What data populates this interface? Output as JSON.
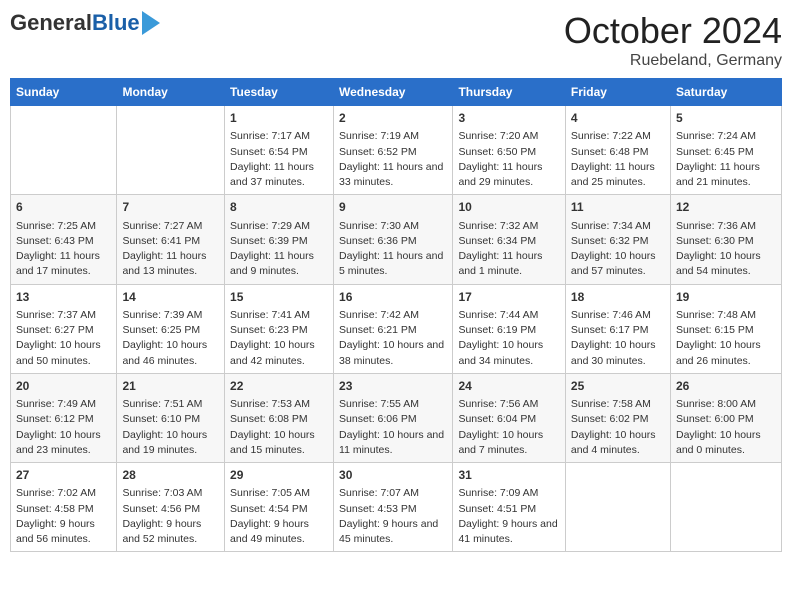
{
  "header": {
    "logo_general": "General",
    "logo_blue": "Blue",
    "title": "October 2024",
    "subtitle": "Ruebeland, Germany"
  },
  "days_of_week": [
    "Sunday",
    "Monday",
    "Tuesday",
    "Wednesday",
    "Thursday",
    "Friday",
    "Saturday"
  ],
  "weeks": [
    [
      {
        "day": "",
        "info": ""
      },
      {
        "day": "",
        "info": ""
      },
      {
        "day": "1",
        "info": "Sunrise: 7:17 AM\nSunset: 6:54 PM\nDaylight: 11 hours and 37 minutes."
      },
      {
        "day": "2",
        "info": "Sunrise: 7:19 AM\nSunset: 6:52 PM\nDaylight: 11 hours and 33 minutes."
      },
      {
        "day": "3",
        "info": "Sunrise: 7:20 AM\nSunset: 6:50 PM\nDaylight: 11 hours and 29 minutes."
      },
      {
        "day": "4",
        "info": "Sunrise: 7:22 AM\nSunset: 6:48 PM\nDaylight: 11 hours and 25 minutes."
      },
      {
        "day": "5",
        "info": "Sunrise: 7:24 AM\nSunset: 6:45 PM\nDaylight: 11 hours and 21 minutes."
      }
    ],
    [
      {
        "day": "6",
        "info": "Sunrise: 7:25 AM\nSunset: 6:43 PM\nDaylight: 11 hours and 17 minutes."
      },
      {
        "day": "7",
        "info": "Sunrise: 7:27 AM\nSunset: 6:41 PM\nDaylight: 11 hours and 13 minutes."
      },
      {
        "day": "8",
        "info": "Sunrise: 7:29 AM\nSunset: 6:39 PM\nDaylight: 11 hours and 9 minutes."
      },
      {
        "day": "9",
        "info": "Sunrise: 7:30 AM\nSunset: 6:36 PM\nDaylight: 11 hours and 5 minutes."
      },
      {
        "day": "10",
        "info": "Sunrise: 7:32 AM\nSunset: 6:34 PM\nDaylight: 11 hours and 1 minute."
      },
      {
        "day": "11",
        "info": "Sunrise: 7:34 AM\nSunset: 6:32 PM\nDaylight: 10 hours and 57 minutes."
      },
      {
        "day": "12",
        "info": "Sunrise: 7:36 AM\nSunset: 6:30 PM\nDaylight: 10 hours and 54 minutes."
      }
    ],
    [
      {
        "day": "13",
        "info": "Sunrise: 7:37 AM\nSunset: 6:27 PM\nDaylight: 10 hours and 50 minutes."
      },
      {
        "day": "14",
        "info": "Sunrise: 7:39 AM\nSunset: 6:25 PM\nDaylight: 10 hours and 46 minutes."
      },
      {
        "day": "15",
        "info": "Sunrise: 7:41 AM\nSunset: 6:23 PM\nDaylight: 10 hours and 42 minutes."
      },
      {
        "day": "16",
        "info": "Sunrise: 7:42 AM\nSunset: 6:21 PM\nDaylight: 10 hours and 38 minutes."
      },
      {
        "day": "17",
        "info": "Sunrise: 7:44 AM\nSunset: 6:19 PM\nDaylight: 10 hours and 34 minutes."
      },
      {
        "day": "18",
        "info": "Sunrise: 7:46 AM\nSunset: 6:17 PM\nDaylight: 10 hours and 30 minutes."
      },
      {
        "day": "19",
        "info": "Sunrise: 7:48 AM\nSunset: 6:15 PM\nDaylight: 10 hours and 26 minutes."
      }
    ],
    [
      {
        "day": "20",
        "info": "Sunrise: 7:49 AM\nSunset: 6:12 PM\nDaylight: 10 hours and 23 minutes."
      },
      {
        "day": "21",
        "info": "Sunrise: 7:51 AM\nSunset: 6:10 PM\nDaylight: 10 hours and 19 minutes."
      },
      {
        "day": "22",
        "info": "Sunrise: 7:53 AM\nSunset: 6:08 PM\nDaylight: 10 hours and 15 minutes."
      },
      {
        "day": "23",
        "info": "Sunrise: 7:55 AM\nSunset: 6:06 PM\nDaylight: 10 hours and 11 minutes."
      },
      {
        "day": "24",
        "info": "Sunrise: 7:56 AM\nSunset: 6:04 PM\nDaylight: 10 hours and 7 minutes."
      },
      {
        "day": "25",
        "info": "Sunrise: 7:58 AM\nSunset: 6:02 PM\nDaylight: 10 hours and 4 minutes."
      },
      {
        "day": "26",
        "info": "Sunrise: 8:00 AM\nSunset: 6:00 PM\nDaylight: 10 hours and 0 minutes."
      }
    ],
    [
      {
        "day": "27",
        "info": "Sunrise: 7:02 AM\nSunset: 4:58 PM\nDaylight: 9 hours and 56 minutes."
      },
      {
        "day": "28",
        "info": "Sunrise: 7:03 AM\nSunset: 4:56 PM\nDaylight: 9 hours and 52 minutes."
      },
      {
        "day": "29",
        "info": "Sunrise: 7:05 AM\nSunset: 4:54 PM\nDaylight: 9 hours and 49 minutes."
      },
      {
        "day": "30",
        "info": "Sunrise: 7:07 AM\nSunset: 4:53 PM\nDaylight: 9 hours and 45 minutes."
      },
      {
        "day": "31",
        "info": "Sunrise: 7:09 AM\nSunset: 4:51 PM\nDaylight: 9 hours and 41 minutes."
      },
      {
        "day": "",
        "info": ""
      },
      {
        "day": "",
        "info": ""
      }
    ]
  ]
}
